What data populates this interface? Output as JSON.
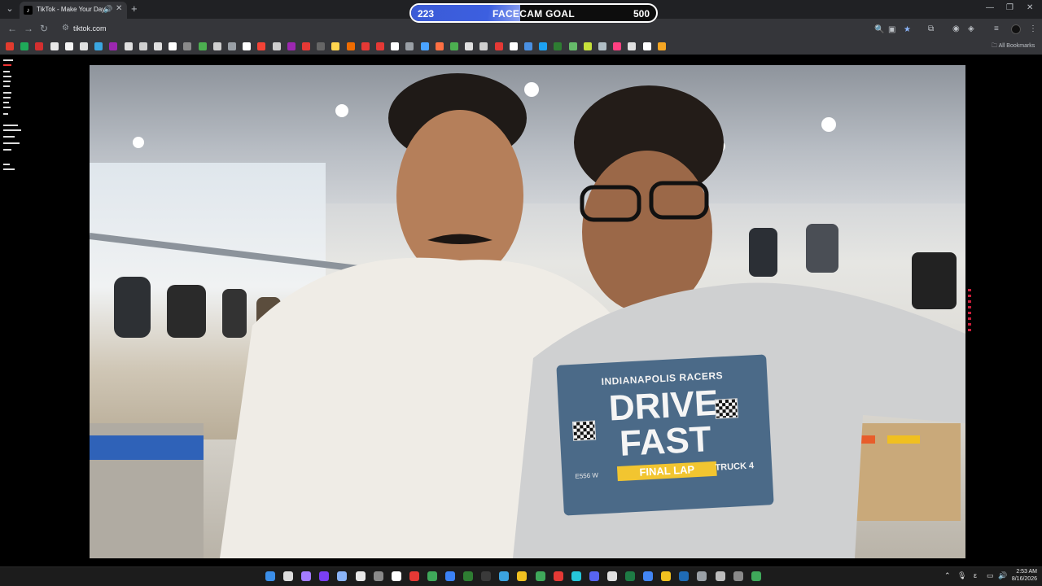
{
  "browser": {
    "tab": {
      "title": "TikTok - Make Your Day",
      "favicon": "tiktok-logo-icon"
    },
    "address": "tiktok.com",
    "bookmarks_all_label": "All Bookmarks",
    "bookmark_colors": [
      "#e23b2e",
      "#1faa59",
      "#d32f2f",
      "#e8e8e8",
      "#f5f5f5",
      "#e0e0e0",
      "#3aa6e0",
      "#9c27b0",
      "#e0e0e0",
      "#cfcfcf",
      "#e0e0e0",
      "#fff",
      "#8a8a8a",
      "#4caf50",
      "#cfcfcf",
      "#9aa0a6",
      "#fff",
      "#f44336",
      "#cfcfcf",
      "#9c27b0",
      "#e53935",
      "#666",
      "#ffd54f",
      "#ef6c00",
      "#e53935",
      "#e53935",
      "#fff",
      "#9aa0a6",
      "#4aa3ff",
      "#ff7043",
      "#4caf50",
      "#e0e0e0",
      "#cfcfcf",
      "#e53935",
      "#fff",
      "#4a90e2",
      "#1da1f2",
      "#2e7d32",
      "#66bb6a",
      "#c6e13a",
      "#b0bec5",
      "#ff4081",
      "#e0e0e0",
      "#fff",
      "#f5a623"
    ]
  },
  "goal": {
    "current": "223",
    "current_value": 223,
    "label": "FACECAM GOAL",
    "target": "500",
    "target_value": 500
  },
  "video": {
    "shirt": {
      "line1": "INDIANAPOLIS RACERS",
      "drive": "DRIVE",
      "fast": "FAST",
      "final_lap": "FINAL LAP",
      "code": "E556 W",
      "truck": "TRUCK 4"
    }
  },
  "taskbar": {
    "icon_colors": [
      "#3b8ee8",
      "#ddd",
      "#a47cff",
      "#7b3ff2",
      "#8ab4f8",
      "#e8e8e8",
      "#8a8a8a",
      "#ffffff",
      "#e53935",
      "#3fa85a",
      "#3b82f6",
      "#2e7d32",
      "#3a3a3a",
      "#3ba3e0",
      "#f0c020",
      "#3fa85a",
      "#e53935",
      "#26c6da",
      "#5865f2",
      "#e0e0e0",
      "#1e7b45",
      "#4285f4",
      "#f0c020",
      "#1f6bb5",
      "#9aa0a6",
      "#bdbdbd",
      "#8a8a8a",
      "#3fa85a"
    ],
    "time": "2:53 AM",
    "date": "8/16/2026"
  }
}
